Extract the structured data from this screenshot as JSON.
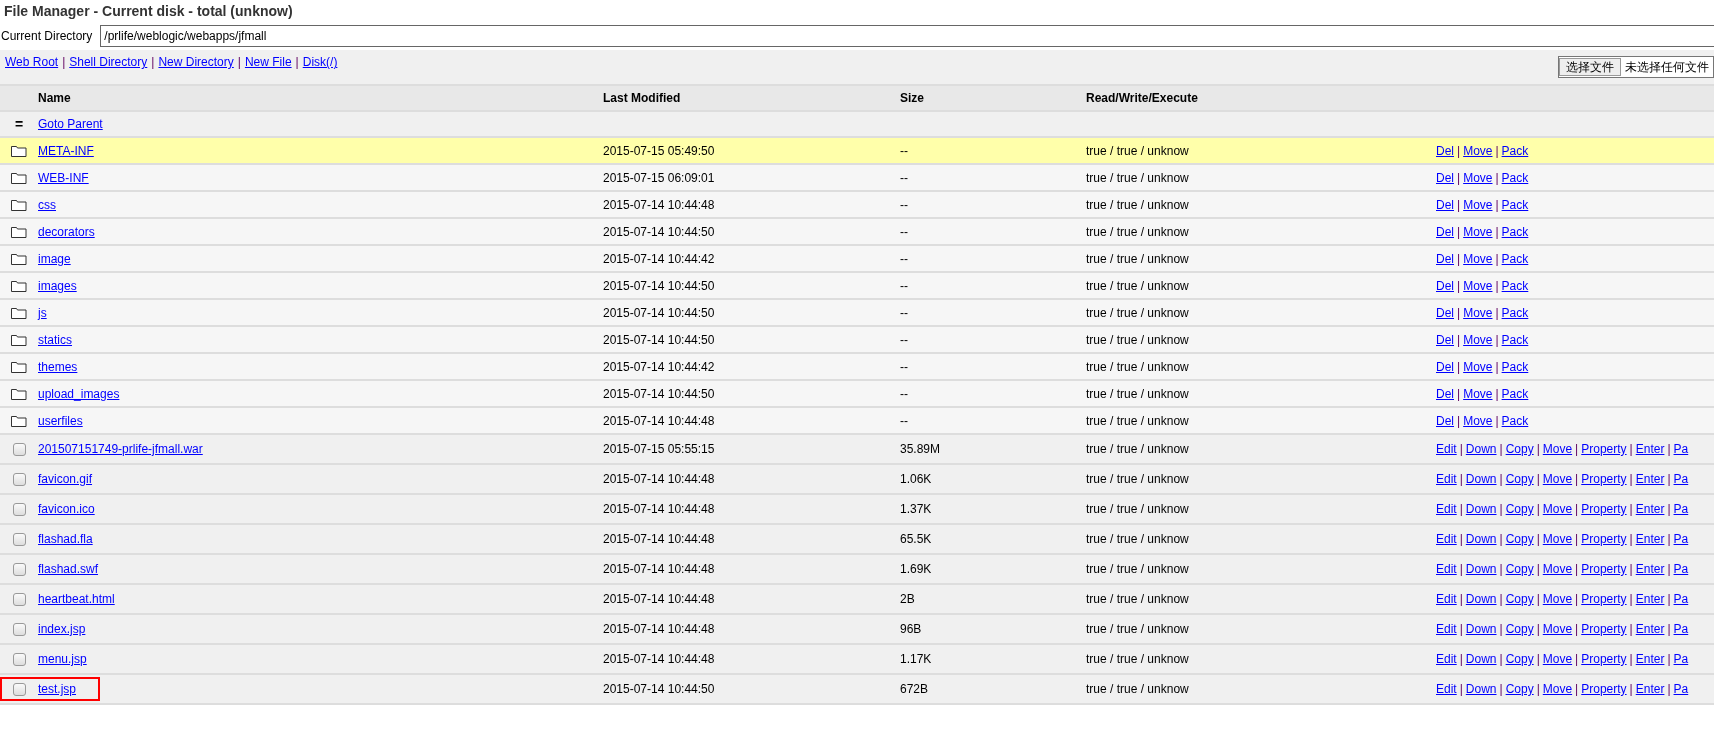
{
  "title": "File Manager - Current disk - total (unknow)",
  "current_directory": {
    "label": "Current Directory",
    "value": "/prlife/weblogic/webapps/jfmall"
  },
  "links": [
    "Web Root",
    "Shell Directory",
    "New Directory",
    "New File",
    "Disk(/)"
  ],
  "link_separator": "|",
  "file_input": {
    "button": "选择文件",
    "status": "未选择任何文件"
  },
  "table": {
    "columns": [
      "Name",
      "Last Modified",
      "Size",
      "Read/Write/Execute"
    ],
    "parent": {
      "mark": "=",
      "label": "Goto Parent"
    },
    "action_separator": "|",
    "rows": [
      {
        "kind": "folder",
        "name": "META-INF",
        "modified": "2015-07-15 05:49:50",
        "size": "--",
        "rwx": "true / true / unknow",
        "actions": [
          "Del",
          "Move",
          "Pack"
        ],
        "highlighted": true,
        "marked": false
      },
      {
        "kind": "folder",
        "name": "WEB-INF",
        "modified": "2015-07-15 06:09:01",
        "size": "--",
        "rwx": "true / true / unknow",
        "actions": [
          "Del",
          "Move",
          "Pack"
        ],
        "highlighted": false,
        "marked": false
      },
      {
        "kind": "folder",
        "name": "css",
        "modified": "2015-07-14 10:44:48",
        "size": "--",
        "rwx": "true / true / unknow",
        "actions": [
          "Del",
          "Move",
          "Pack"
        ],
        "highlighted": false,
        "marked": false
      },
      {
        "kind": "folder",
        "name": "decorators",
        "modified": "2015-07-14 10:44:50",
        "size": "--",
        "rwx": "true / true / unknow",
        "actions": [
          "Del",
          "Move",
          "Pack"
        ],
        "highlighted": false,
        "marked": false
      },
      {
        "kind": "folder",
        "name": "image",
        "modified": "2015-07-14 10:44:42",
        "size": "--",
        "rwx": "true / true / unknow",
        "actions": [
          "Del",
          "Move",
          "Pack"
        ],
        "highlighted": false,
        "marked": false
      },
      {
        "kind": "folder",
        "name": "images",
        "modified": "2015-07-14 10:44:50",
        "size": "--",
        "rwx": "true / true / unknow",
        "actions": [
          "Del",
          "Move",
          "Pack"
        ],
        "highlighted": false,
        "marked": false
      },
      {
        "kind": "folder",
        "name": "js",
        "modified": "2015-07-14 10:44:50",
        "size": "--",
        "rwx": "true / true / unknow",
        "actions": [
          "Del",
          "Move",
          "Pack"
        ],
        "highlighted": false,
        "marked": false
      },
      {
        "kind": "folder",
        "name": "statics",
        "modified": "2015-07-14 10:44:50",
        "size": "--",
        "rwx": "true / true / unknow",
        "actions": [
          "Del",
          "Move",
          "Pack"
        ],
        "highlighted": false,
        "marked": false
      },
      {
        "kind": "folder",
        "name": "themes",
        "modified": "2015-07-14 10:44:42",
        "size": "--",
        "rwx": "true / true / unknow",
        "actions": [
          "Del",
          "Move",
          "Pack"
        ],
        "highlighted": false,
        "marked": false
      },
      {
        "kind": "folder",
        "name": "upload_images",
        "modified": "2015-07-14 10:44:50",
        "size": "--",
        "rwx": "true / true / unknow",
        "actions": [
          "Del",
          "Move",
          "Pack"
        ],
        "highlighted": false,
        "marked": false
      },
      {
        "kind": "folder",
        "name": "userfiles",
        "modified": "2015-07-14 10:44:48",
        "size": "--",
        "rwx": "true / true / unknow",
        "actions": [
          "Del",
          "Move",
          "Pack"
        ],
        "highlighted": false,
        "marked": false
      },
      {
        "kind": "file",
        "checked": false,
        "name": "201507151749-prlife-jfmall.war",
        "modified": "2015-07-15 05:55:15",
        "size": "35.89M",
        "rwx": "true / true / unknow",
        "actions": [
          "Edit",
          "Down",
          "Copy",
          "Move",
          "Property",
          "Enter",
          "Pa"
        ],
        "highlighted": false,
        "marked": false
      },
      {
        "kind": "file",
        "checked": false,
        "name": "favicon.gif",
        "modified": "2015-07-14 10:44:48",
        "size": "1.06K",
        "rwx": "true / true / unknow",
        "actions": [
          "Edit",
          "Down",
          "Copy",
          "Move",
          "Property",
          "Enter",
          "Pa"
        ],
        "highlighted": false,
        "marked": false
      },
      {
        "kind": "file",
        "checked": false,
        "name": "favicon.ico",
        "modified": "2015-07-14 10:44:48",
        "size": "1.37K",
        "rwx": "true / true / unknow",
        "actions": [
          "Edit",
          "Down",
          "Copy",
          "Move",
          "Property",
          "Enter",
          "Pa"
        ],
        "highlighted": false,
        "marked": false
      },
      {
        "kind": "file",
        "checked": false,
        "name": "flashad.fla",
        "modified": "2015-07-14 10:44:48",
        "size": "65.5K",
        "rwx": "true / true / unknow",
        "actions": [
          "Edit",
          "Down",
          "Copy",
          "Move",
          "Property",
          "Enter",
          "Pa"
        ],
        "highlighted": false,
        "marked": false
      },
      {
        "kind": "file",
        "checked": false,
        "name": "flashad.swf",
        "modified": "2015-07-14 10:44:48",
        "size": "1.69K",
        "rwx": "true / true / unknow",
        "actions": [
          "Edit",
          "Down",
          "Copy",
          "Move",
          "Property",
          "Enter",
          "Pa"
        ],
        "highlighted": false,
        "marked": false
      },
      {
        "kind": "file",
        "checked": false,
        "name": "heartbeat.html",
        "modified": "2015-07-14 10:44:48",
        "size": "2B",
        "rwx": "true / true / unknow",
        "actions": [
          "Edit",
          "Down",
          "Copy",
          "Move",
          "Property",
          "Enter",
          "Pa"
        ],
        "highlighted": false,
        "marked": false
      },
      {
        "kind": "file",
        "checked": false,
        "name": "index.jsp",
        "modified": "2015-07-14 10:44:48",
        "size": "96B",
        "rwx": "true / true / unknow",
        "actions": [
          "Edit",
          "Down",
          "Copy",
          "Move",
          "Property",
          "Enter",
          "Pa"
        ],
        "highlighted": false,
        "marked": false
      },
      {
        "kind": "file",
        "checked": false,
        "name": "menu.jsp",
        "modified": "2015-07-14 10:44:48",
        "size": "1.17K",
        "rwx": "true / true / unknow",
        "actions": [
          "Edit",
          "Down",
          "Copy",
          "Move",
          "Property",
          "Enter",
          "Pa"
        ],
        "highlighted": false,
        "marked": false
      },
      {
        "kind": "file",
        "checked": false,
        "name": "test.jsp",
        "modified": "2015-07-14 10:44:50",
        "size": "672B",
        "rwx": "true / true / unknow",
        "actions": [
          "Edit",
          "Down",
          "Copy",
          "Move",
          "Property",
          "Enter",
          "Pa"
        ],
        "highlighted": false,
        "marked": true
      }
    ]
  }
}
